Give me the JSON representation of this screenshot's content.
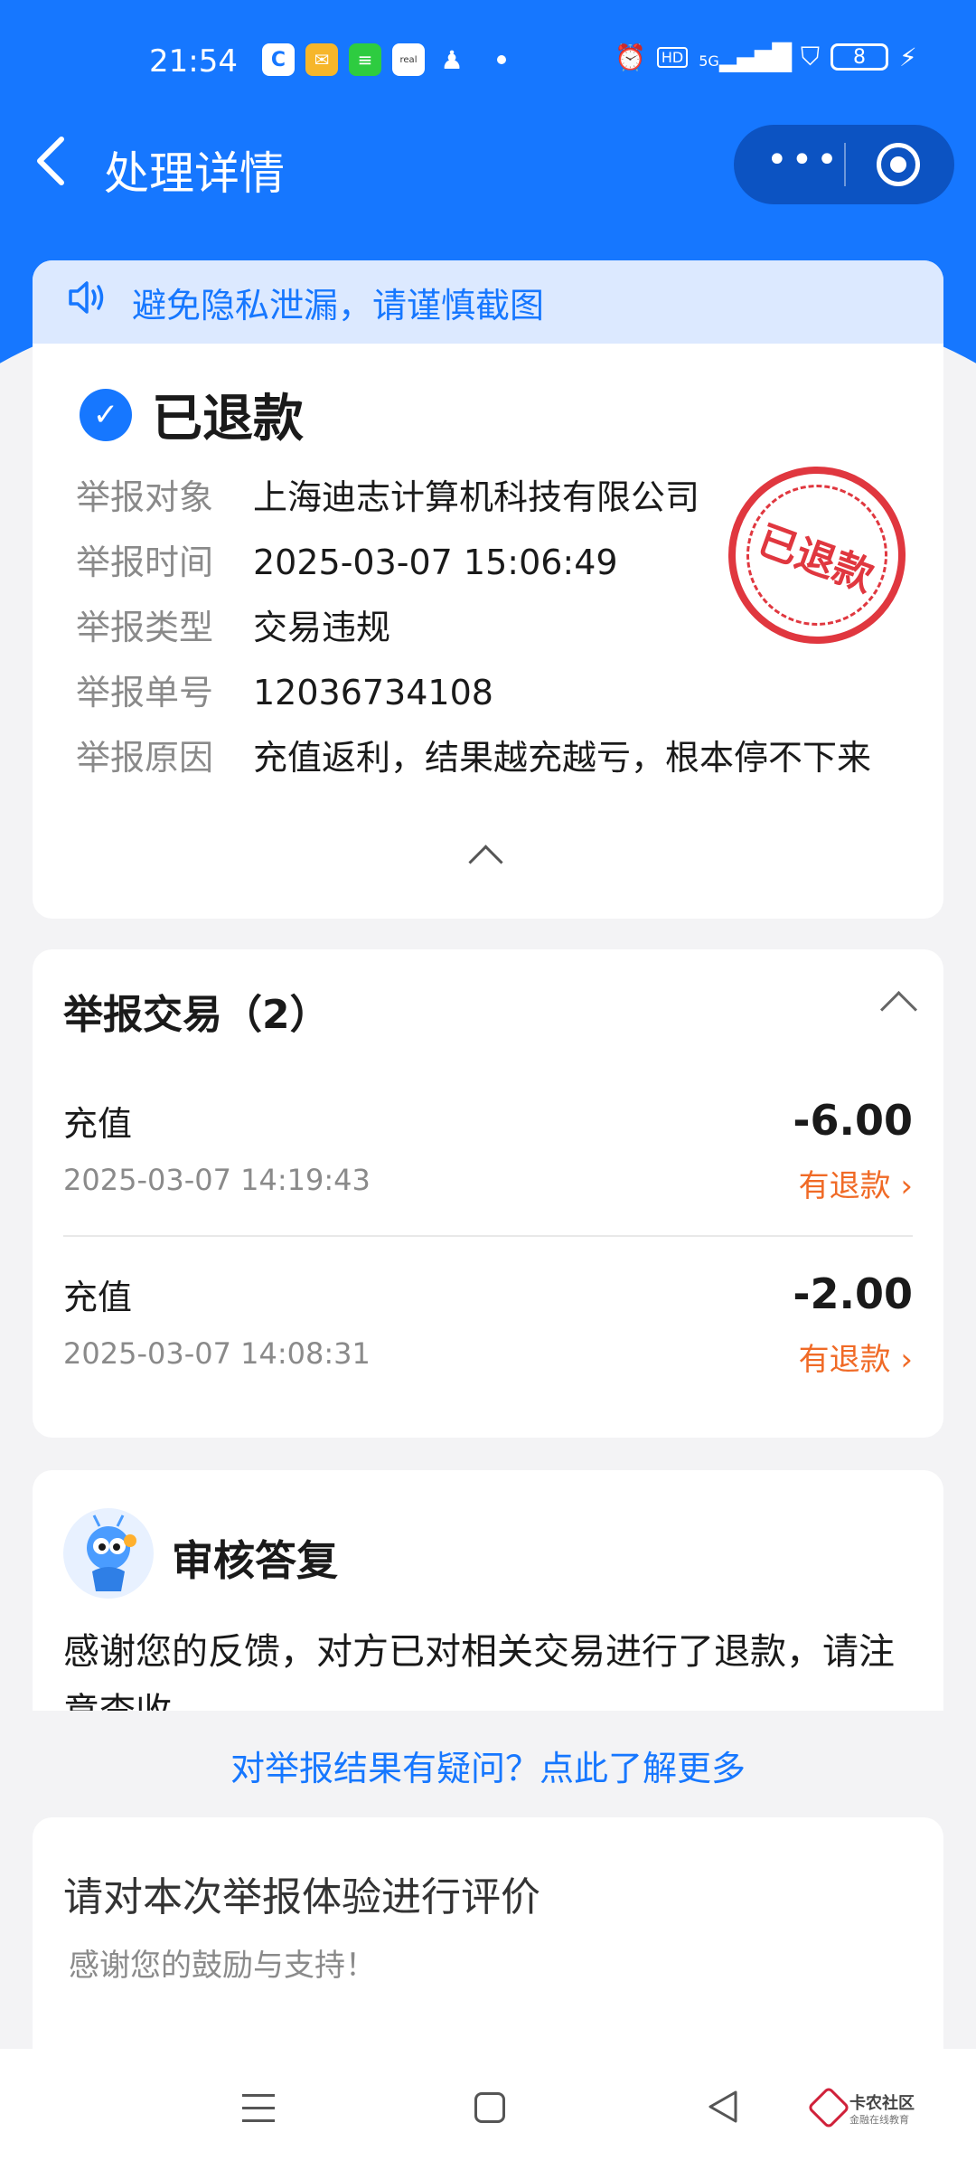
{
  "status_bar": {
    "time": "21:54",
    "app_icons": [
      "c-app-icon",
      "mail-icon",
      "message-icon",
      "realme-icon",
      "qq-icon"
    ],
    "right_icons": [
      "alarm-icon",
      "hd-icon",
      "5g-signal-icon",
      "vpn-shield-icon"
    ],
    "hd": "HD",
    "signal": "5G",
    "battery": "8"
  },
  "nav": {
    "back_icon": "chevron-left-icon",
    "title": "处理详情",
    "more": "•••"
  },
  "notice": {
    "icon": "speaker-icon",
    "text": "避免隐私泄漏，请谨慎截图"
  },
  "status": {
    "text": "已退款",
    "stamp": "已退款"
  },
  "details": [
    {
      "label": "举报对象",
      "value": "上海迪志计算机科技有限公司"
    },
    {
      "label": "举报时间",
      "value": "2025-03-07 15:06:49"
    },
    {
      "label": "举报类型",
      "value": "交易违规"
    },
    {
      "label": "举报单号",
      "value": "12036734108"
    },
    {
      "label": "举报原因",
      "value": "充值返利，结果越充越亏，根本停不下来"
    }
  ],
  "transactions": {
    "title": "举报交易（2）",
    "items": [
      {
        "type": "充值",
        "amount": "-6.00",
        "time": "2025-03-07 14:19:43",
        "refund": "有退款 ›"
      },
      {
        "type": "充值",
        "amount": "-2.00",
        "time": "2025-03-07 14:08:31",
        "refund": "有退款 ›"
      }
    ]
  },
  "reply": {
    "title": "审核答复",
    "text": "感谢您的反馈，对方已对相关交易进行了退款，请注意查收"
  },
  "link": "对举报结果有疑问？点此了解更多",
  "rating": {
    "title": "请对本次举报体验进行评价",
    "subtitle": "感谢您的鼓励与支持！"
  },
  "watermark": {
    "name": "卡农社区",
    "sub": "金融在线教育"
  },
  "colors": {
    "brand_blue": "#1677ff",
    "refund_orange": "#f06a26",
    "stamp_red": "#e0373f",
    "notice_bg": "#dce9ff"
  }
}
